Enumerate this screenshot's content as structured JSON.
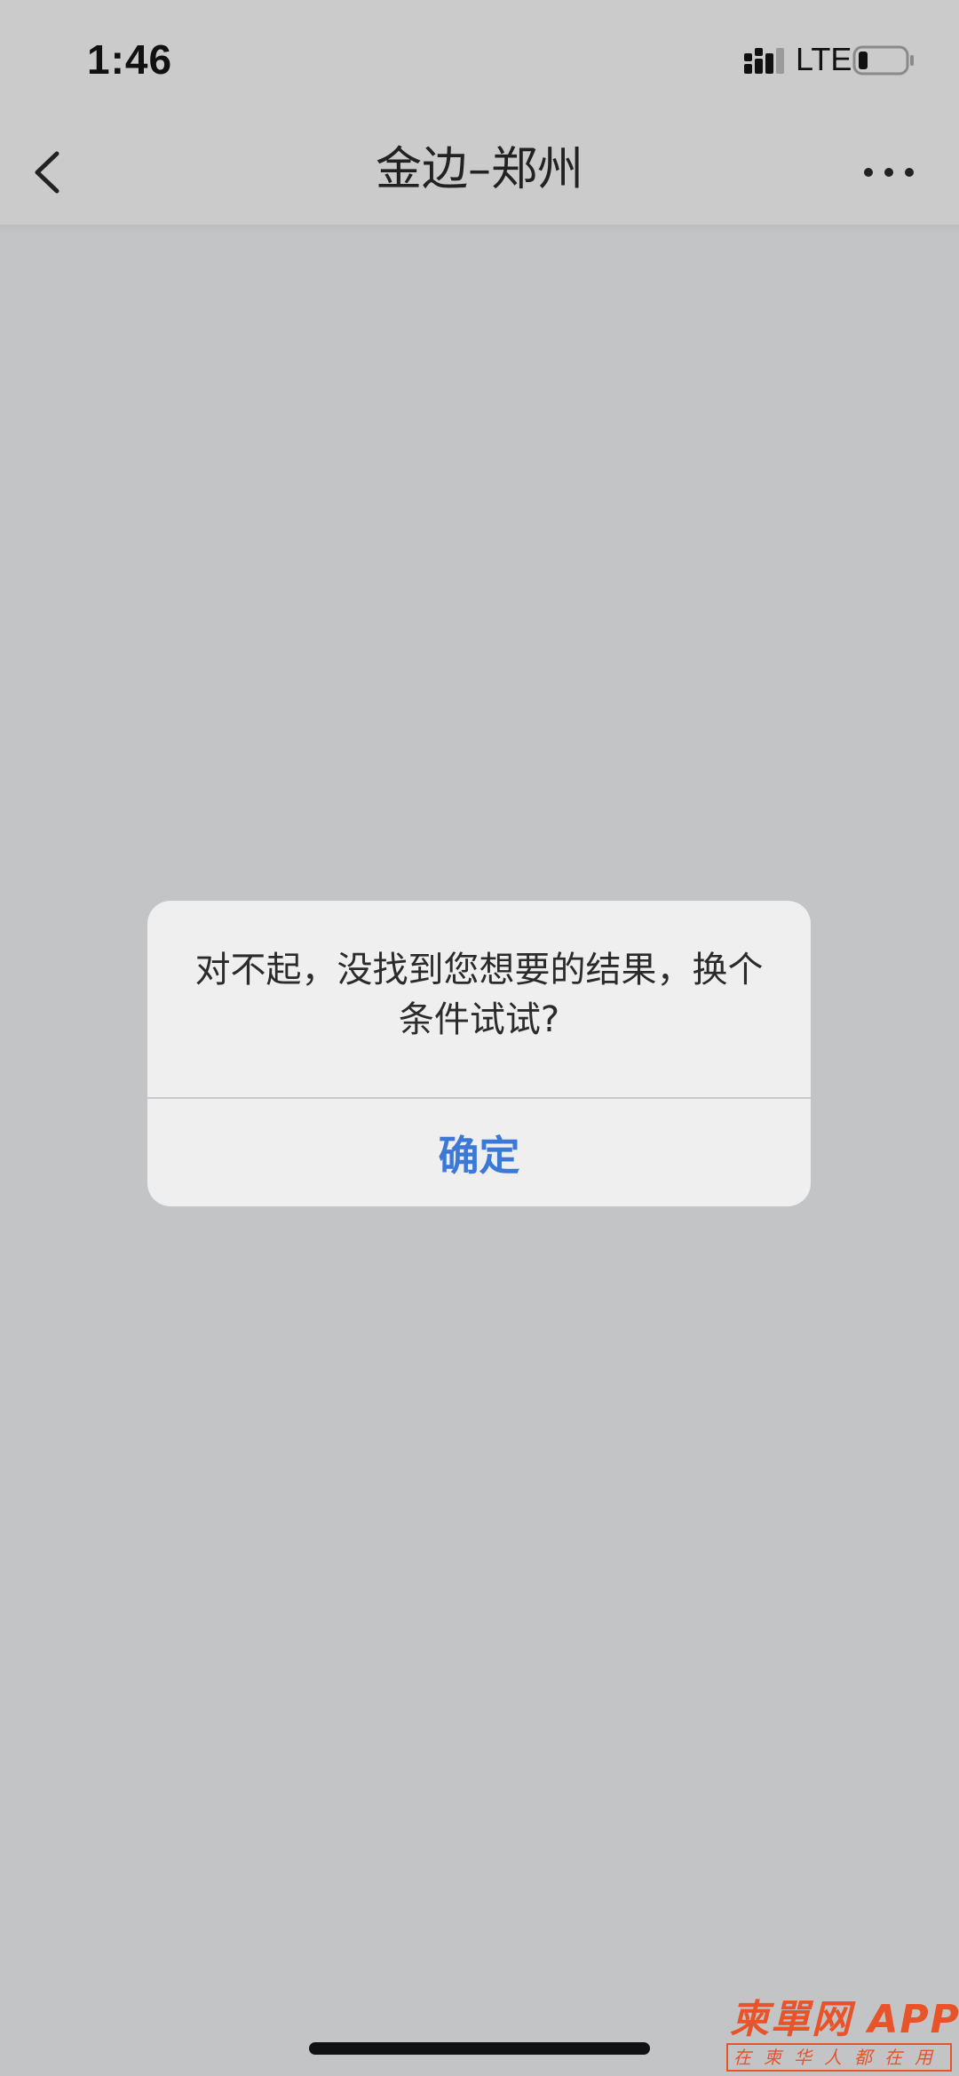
{
  "status_bar": {
    "time": "1:46",
    "network": "LTE",
    "signal_icon": "cellular-signal-icon",
    "battery_icon": "battery-low-icon"
  },
  "nav": {
    "title": "金边–郑州",
    "back_icon": "chevron-left-icon",
    "more_icon": "more-horizontal-icon"
  },
  "alert": {
    "message": "对不起，没找到您想要的结果，换个条件试试?",
    "confirm_label": "确定"
  },
  "watermark": {
    "name": "柬單网",
    "suffix": "APP",
    "tagline": "在柬华人都在用"
  },
  "colors": {
    "accent": "#3c79d6",
    "watermark": "#e8532a",
    "background": "#c3c4c6"
  }
}
